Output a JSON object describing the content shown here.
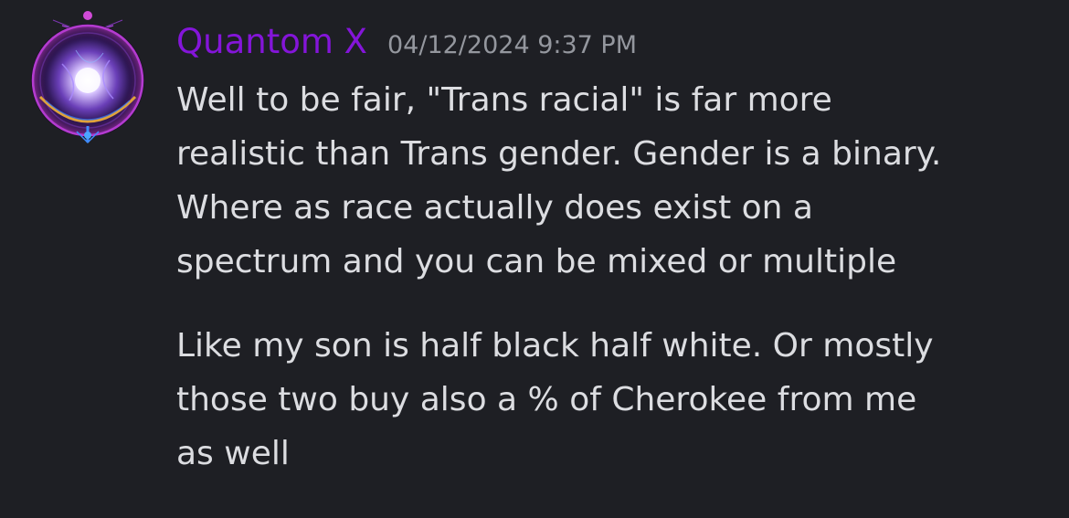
{
  "message": {
    "author": "Quantom X",
    "timestamp": "04/12/2024 9:37 PM",
    "avatar_icon": "cosmic-orb-avatar",
    "author_color": "#8415d9",
    "paragraphs": [
      {
        "lines": [
          "Well to be fair, \"Trans racial\" is far more",
          "realistic than Trans gender. Gender is a binary.",
          "Where as race actually does exist on a",
          "spectrum and you can be mixed or multiple"
        ]
      },
      {
        "lines": [
          "Like my son is half black half white. Or mostly",
          "those two buy also a % of Cherokee from me",
          "as well"
        ]
      }
    ]
  }
}
